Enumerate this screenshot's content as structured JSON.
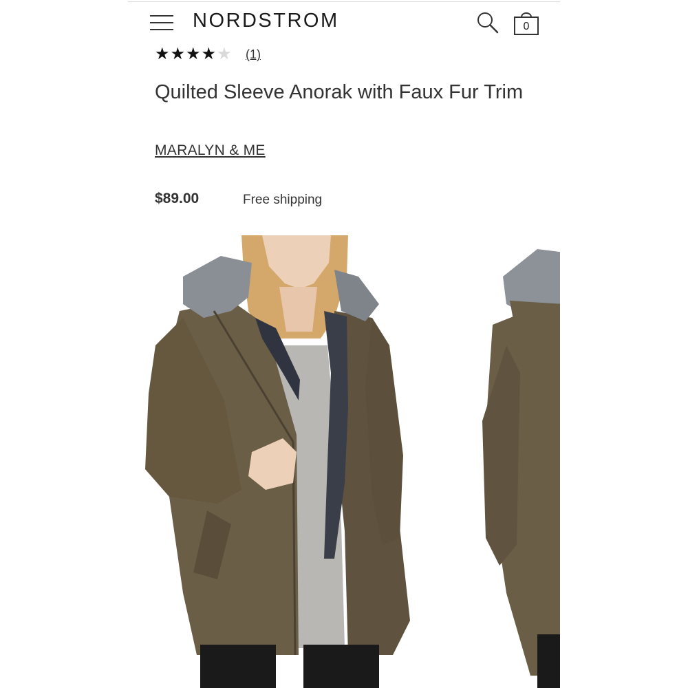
{
  "header": {
    "logo": "NORDSTROM",
    "bag_count": "0"
  },
  "product": {
    "rating": 4,
    "rating_max": 5,
    "review_count": "(1)",
    "title": "Quilted Sleeve Anorak with Faux Fur Trim",
    "brand": "MARALYN & ME",
    "price": "$89.00",
    "shipping": "Free shipping"
  },
  "colors": {
    "jacket": "#6b5e47",
    "fur": "#8a8f95",
    "sweater": "#b9b7b3",
    "text": "#333333"
  },
  "icons": {
    "menu": "hamburger-icon",
    "search": "search-icon",
    "bag": "shopping-bag-icon",
    "star": "star-icon"
  }
}
